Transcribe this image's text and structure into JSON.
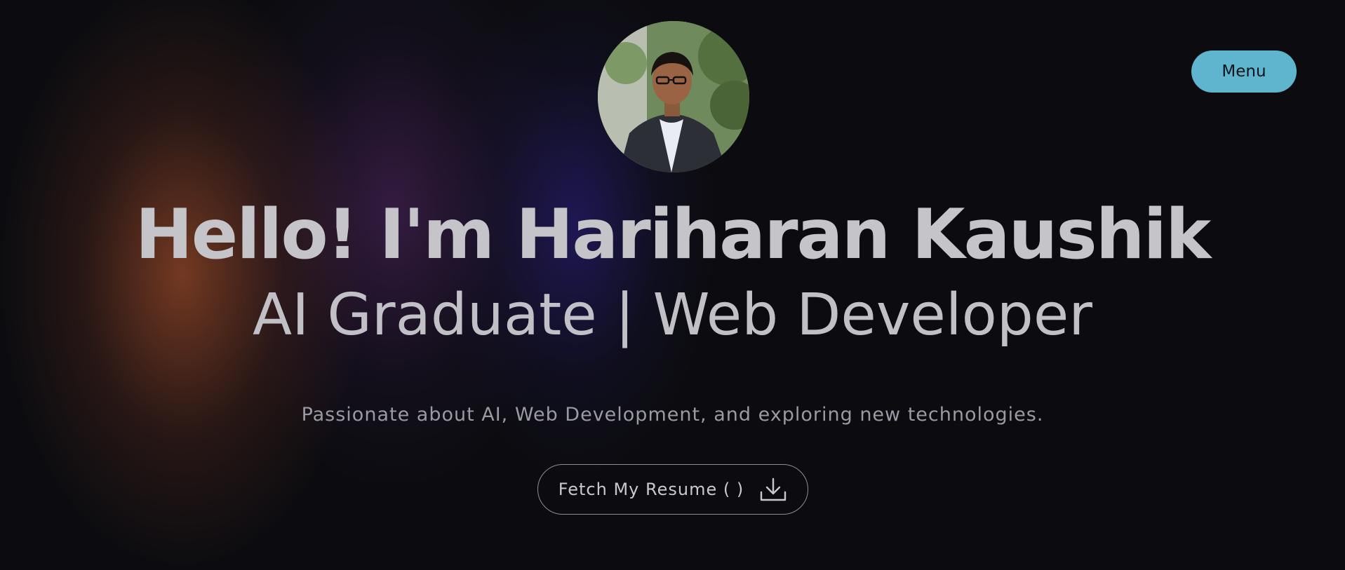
{
  "header": {
    "menu_label": "Menu"
  },
  "hero": {
    "headline": "Hello! I'm Hariharan Kaushik",
    "subheadline": "AI Graduate | Web Developer",
    "tagline": "Passionate about AI, Web Development, and exploring new technologies.",
    "resume_button_label": "Fetch My Resume ( )"
  },
  "icons": {
    "resume": "download-icon",
    "profile": "profile-photo"
  },
  "colors": {
    "background": "#0c0c10",
    "menu_button": "#5fb5cd",
    "headline_text": "#c4c4c9",
    "tagline_text": "#9a9aa4",
    "glow_orange": "#96482a",
    "glow_indigo": "#281e78"
  }
}
